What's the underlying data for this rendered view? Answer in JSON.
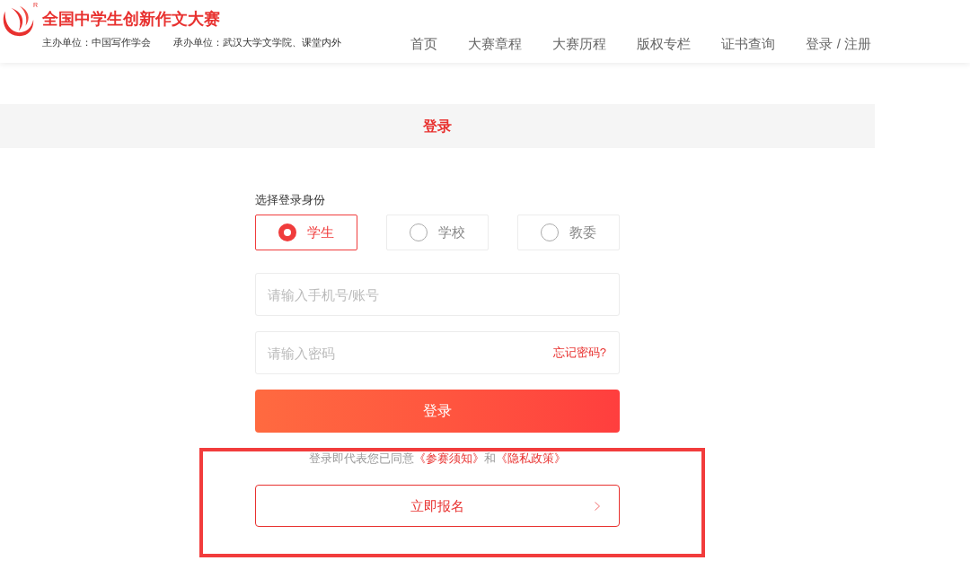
{
  "header": {
    "trademark": "R",
    "title": "全国中学生创新作文大赛",
    "organizers": [
      "主办单位：中国写作学会",
      "承办单位：武汉大学文学院、课堂内外"
    ]
  },
  "nav": [
    {
      "label": "首页"
    },
    {
      "label": "大赛章程"
    },
    {
      "label": "大赛历程"
    },
    {
      "label": "版权专栏"
    },
    {
      "label": "证书查询"
    },
    {
      "label": "登录 / 注册"
    }
  ],
  "page_title": "登录",
  "login_form": {
    "role_label": "选择登录身份",
    "roles": [
      {
        "label": "学生",
        "selected": true
      },
      {
        "label": "学校",
        "selected": false
      },
      {
        "label": "教委",
        "selected": false
      }
    ],
    "account_field": {
      "placeholder": "请输入手机号/账号"
    },
    "password_field": {
      "placeholder": "请输入密码",
      "forgot_link": "忘记密码?"
    },
    "submit_button": "登录"
  },
  "signup_section": {
    "highlighted": true,
    "agreement": [
      {
        "kind": "text",
        "text": "登录即代表您已同意"
      },
      {
        "kind": "link",
        "text": "《参赛须知》"
      },
      {
        "kind": "text",
        "text": "和"
      },
      {
        "kind": "link",
        "text": "《隐私政策》"
      }
    ],
    "signup_button": "立即报名"
  }
}
